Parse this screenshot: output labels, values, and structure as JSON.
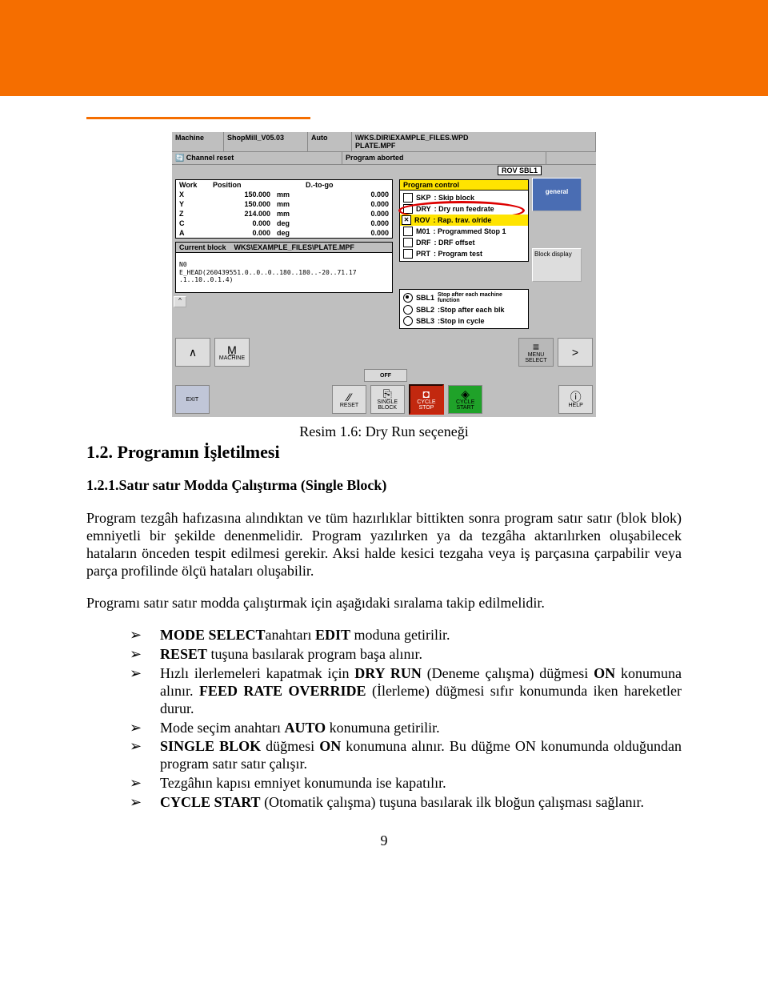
{
  "cnc": {
    "machine_label": "Machine",
    "shopmill": "ShopMill_V05.03",
    "auto": "Auto",
    "path1": "\\WKS.DIR\\EXAMPLE_FILES.WPD",
    "path2": "PLATE.MPF",
    "channel_reset": "Channel reset",
    "program_aborted": "Program aborted",
    "rov_sbl1": "ROV  SBL1",
    "side_general": "general",
    "side_block": "Block display",
    "headers": {
      "work": "Work",
      "position": "Position",
      "dtogo": "D.-to-go"
    },
    "axes": [
      {
        "name": "X",
        "pos": "150.000",
        "unit": "mm",
        "dtg": "0.000"
      },
      {
        "name": "Y",
        "pos": "150.000",
        "unit": "mm",
        "dtg": "0.000"
      },
      {
        "name": "Z",
        "pos": "214.000",
        "unit": "mm",
        "dtg": "0.000"
      },
      {
        "name": "C",
        "pos": "0.000",
        "unit": "deg",
        "dtg": "0.000"
      },
      {
        "name": "A",
        "pos": "0.000",
        "unit": "deg",
        "dtg": "0.000"
      }
    ],
    "current_block_label": "Current block",
    "current_block_path": "WKS\\EXAMPLE_FILES\\PLATE.MPF",
    "current_block_lines": "N0\nE_HEAD(260439551.0..0..0..180..180..-20..71.17\n.1..10..0.1.4)",
    "program_control": "Program control",
    "pc": [
      {
        "code": "SKP",
        "label": ": Skip block",
        "on": false
      },
      {
        "code": "DRY",
        "label": ": Dry run feedrate",
        "on": false,
        "highlight": "oval"
      },
      {
        "code": "ROV",
        "label": ": Rap. trav. o/ride",
        "on": true,
        "rov": true
      },
      {
        "code": "M01",
        "label": ": Programmed Stop 1",
        "on": false
      },
      {
        "code": "DRF",
        "label": ": DRF offset",
        "on": false
      },
      {
        "code": "PRT",
        "label": ": Program test",
        "on": false
      }
    ],
    "sbl": [
      {
        "name": "SBL1",
        "label": "Stop after each machine function",
        "on": true
      },
      {
        "name": "SBL2",
        "label": ":Stop after each blk",
        "on": false
      },
      {
        "name": "SBL3",
        "label": ":Stop in cycle",
        "on": false
      }
    ],
    "softkeys_top": {
      "left": [
        {
          "icon": "∧",
          "label": ""
        },
        {
          "icon": "M̲",
          "label": "MACHINE"
        }
      ],
      "right": [
        {
          "icon": "≡",
          "label": "MENU SELECT"
        },
        {
          "icon": ">",
          "label": ""
        }
      ]
    },
    "off_label": "OFF",
    "softkeys_bottom": {
      "exit": "EXIT",
      "reset": {
        "icon": "⁄⁄",
        "label": "RESET"
      },
      "single_block": {
        "icon": "⎘",
        "label": "SINGLE BLOCK"
      },
      "cycle_stop": {
        "icon": "◘",
        "label": "CYCLE STOP"
      },
      "cycle_start": {
        "icon": "◈",
        "label": "CYCLE START"
      },
      "info": {
        "icon": "ⓘ",
        "label": "HELP"
      }
    }
  },
  "doc": {
    "caption": "Resim 1.6: Dry Run seçeneği",
    "section": "1.2. Programın İşletilmesi",
    "subsection": "1.2.1.Satır satır Modda Çalıştırma (Single Block)",
    "para1": "Program tezgâh hafızasına alındıktan ve tüm hazırlıklar bittikten sonra program satır satır (blok blok) emniyetli bir şekilde denenmelidir. Program yazılırken ya da tezgâha aktarılırken oluşabilecek hataların önceden tespit edilmesi gerekir. Aksi halde kesici tezgaha veya iş parçasına çarpabilir veya parça profilinde ölçü hataları oluşabilir.",
    "para2": "Programı satır satır modda çalıştırmak için aşağıdaki sıralama takip edilmelidir.",
    "b1": "MODE SELECTanahtarı EDIT moduna getirilir.",
    "b2": "RESET tuşuna basılarak program başa alınır.",
    "b3": "Hızlı ilerlemeleri kapatmak için DRY RUN (Deneme çalışma) düğmesi ON konumuna alınır. FEED RATE OVERRIDE (İlerleme) düğmesi sıfır konumunda iken hareketler durur.",
    "b4": "Mode seçim anahtarı AUTO konumuna getirilir.",
    "b5": "SINGLE BLOK düğmesi ON konumuna alınır. Bu düğme ON konumunda olduğundan program satır satır çalışır.",
    "b6": "Tezgâhın kapısı emniyet konumunda ise kapatılır.",
    "b7": "CYCLE START (Otomatik çalışma) tuşuna basılarak ilk bloğun çalışması sağlanır.",
    "page": "9"
  }
}
